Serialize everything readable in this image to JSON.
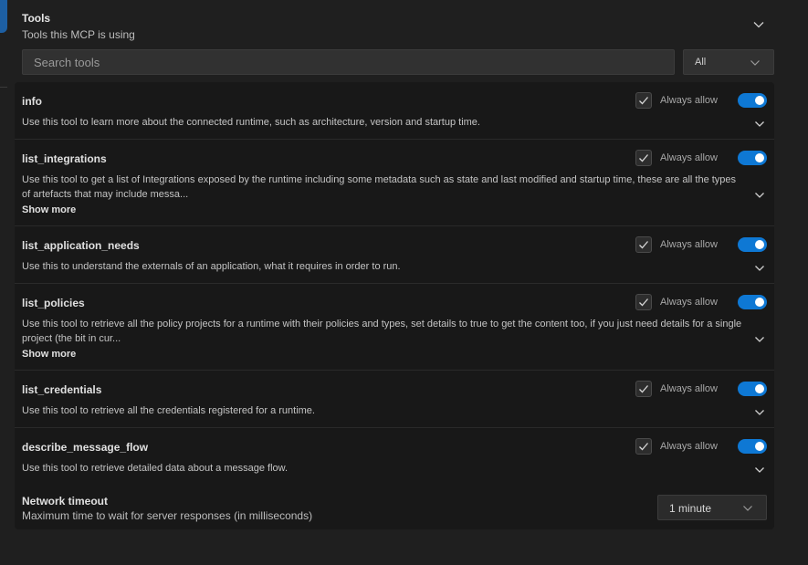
{
  "header": {
    "title": "Tools",
    "subtitle": "Tools this MCP is using"
  },
  "search": {
    "placeholder": "Search tools",
    "value": ""
  },
  "filter": {
    "selected": "All"
  },
  "tools": [
    {
      "name": "info",
      "description": "Use this tool to learn more about the connected runtime, such as architecture, version and startup time.",
      "always_allow_label": "Always allow",
      "always_allow_checked": true,
      "enabled": true
    },
    {
      "name": "list_integrations",
      "description": "Use this tool to get a list of Integrations exposed by the runtime including some metadata such as state and last modified and startup time, these are all the types of artefacts that may include messa...",
      "show_more_label": "Show more",
      "always_allow_label": "Always allow",
      "always_allow_checked": true,
      "enabled": true
    },
    {
      "name": "list_application_needs",
      "description": "Use this to understand the externals of an application, what it requires in order to run.",
      "always_allow_label": "Always allow",
      "always_allow_checked": true,
      "enabled": true
    },
    {
      "name": "list_policies",
      "description": "Use this tool to retrieve all the policy projects for a runtime with their policies and types, set details to true to get the content too, if you just need details for a single project (the bit in cur...",
      "show_more_label": "Show more",
      "always_allow_label": "Always allow",
      "always_allow_checked": true,
      "enabled": true
    },
    {
      "name": "list_credentials",
      "description": "Use this tool to retrieve all the credentials registered for a runtime.",
      "always_allow_label": "Always allow",
      "always_allow_checked": true,
      "enabled": true
    },
    {
      "name": "describe_message_flow",
      "description": "Use this tool to retrieve detailed data about a message flow.",
      "always_allow_label": "Always allow",
      "always_allow_checked": true,
      "enabled": true
    }
  ],
  "network_timeout": {
    "title": "Network timeout",
    "subtitle": "Maximum time to wait for server responses (in milliseconds)",
    "selected": "1 minute"
  },
  "icons": {
    "header_toggle": "chevron-down-icon",
    "filter_dropdown": "chevron-down-icon",
    "row_expand": "chevron-down-icon",
    "checkbox": "checkmark-icon"
  },
  "colors": {
    "toggle_on": "#0e78d4",
    "background": "#1f1f1f",
    "panel": "#181818"
  }
}
